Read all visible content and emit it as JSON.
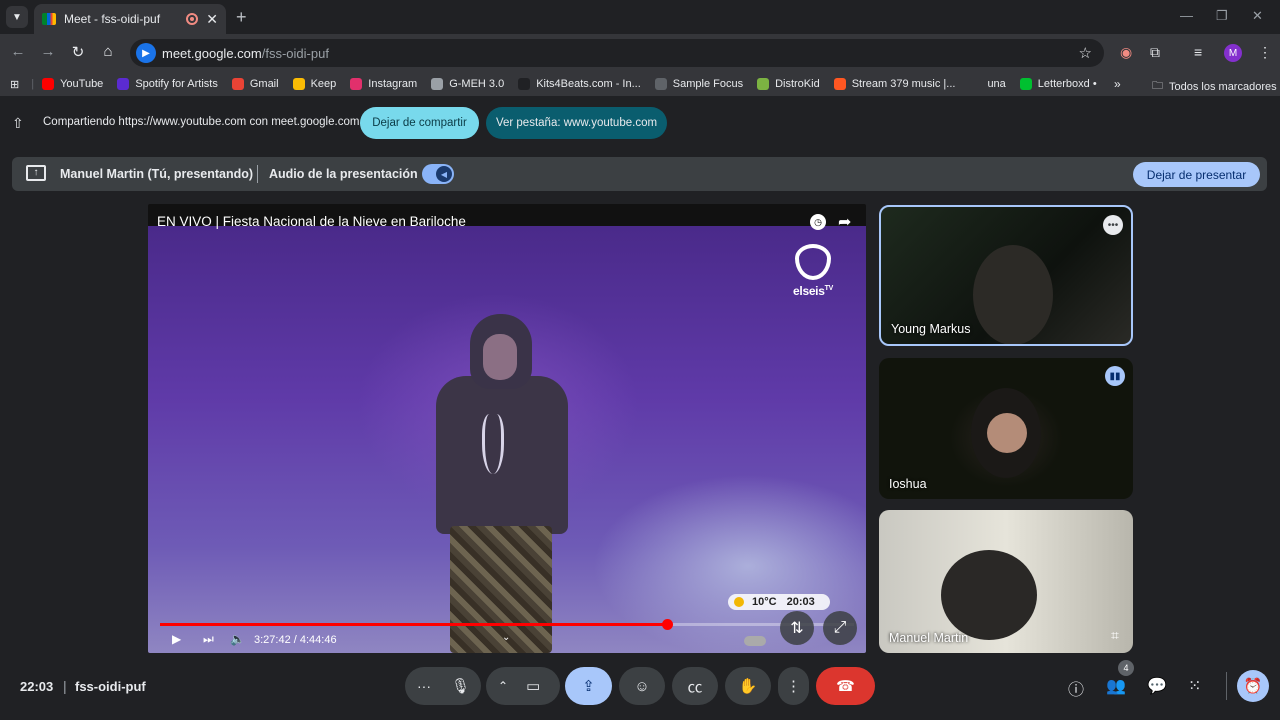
{
  "browser": {
    "tab_title": "Meet - fss-oidi-puf",
    "url_host": "meet.google.com",
    "url_path": "/fss-oidi-puf",
    "profile_initial": "M",
    "bookmarks": [
      {
        "label": "YouTube",
        "color": "#ff0000"
      },
      {
        "label": "Spotify for Artists",
        "color": "#5b2bd1"
      },
      {
        "label": "Gmail",
        "color": "#ea4335"
      },
      {
        "label": "Keep",
        "color": "#fbbc04"
      },
      {
        "label": "Instagram",
        "color": "#e1306c"
      },
      {
        "label": "G-MEH 3.0",
        "color": "#9aa0a6"
      },
      {
        "label": "Kits4Beats.com - In...",
        "color": "#202124"
      },
      {
        "label": "Sample Focus",
        "color": "#5f6368"
      },
      {
        "label": "DistroKid",
        "color": "#7cb342"
      },
      {
        "label": "Stream 379 music |...",
        "color": "#ff5722"
      },
      {
        "label": "una",
        "color": "#35363a"
      },
      {
        "label": "Letterboxd •",
        "color": "#00c030"
      }
    ],
    "all_bookmarks_label": "Todos los marcadores"
  },
  "share_notice": {
    "text": "Compartiendo https://www.youtube.com con meet.google.com",
    "stop_label": "Dejar de compartir",
    "view_label": "Ver pestaña: www.youtube.com"
  },
  "present_bar": {
    "presenter": "Manuel Martin (Tú, presentando)",
    "audio_label": "Audio de la presentación",
    "stop_label": "Dejar de presentar"
  },
  "video": {
    "title": "EN VIVO | Fiesta Nacional de la Nieve en Bariloche",
    "channel": "elseis",
    "channel_sup": "TV",
    "time": "3:27:42 / 4:44:46",
    "progress": 0.73,
    "weather_temp": "10°C",
    "weather_time": "20:03"
  },
  "participants": [
    {
      "name": "Young Markus"
    },
    {
      "name": "Ioshua"
    },
    {
      "name": "Manuel Martin"
    }
  ],
  "meeting": {
    "time": "22:03",
    "code": "fss-oidi-puf",
    "people_count": "4"
  },
  "colors": {
    "accent": "#a8c7fa",
    "hangup": "#dc362e",
    "stop_share": "#78d9ec"
  }
}
